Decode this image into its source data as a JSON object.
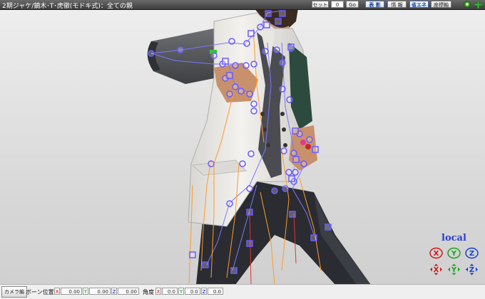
{
  "window": {
    "title": "2期ジャケ/鏑木･T･虎徹(モドキ式)：全ての親"
  },
  "toolbar": {
    "frame_label": "セット",
    "frame_value": "0",
    "go_label": "Go",
    "view_buttons": [
      "表 影",
      "情 報",
      "省エネ",
      "座標軸"
    ],
    "active_view_buttons": [
      "表 影",
      "省エネ"
    ]
  },
  "viewport": {
    "mode_label": "local",
    "gizmo_icons": [
      "rotate-x-icon",
      "rotate-y-icon",
      "rotate-z-icon",
      "move-x-icon",
      "move-y-icon",
      "move-z-icon"
    ],
    "gizmo_letters": {
      "x": "X",
      "y": "Y",
      "z": "Z"
    },
    "colors": {
      "x": "#d11a1a",
      "y": "#1aa31a",
      "z": "#1a44d1",
      "bone_marker": "#6a5cff",
      "ik_bone_marker": "#ff9a2a"
    }
  },
  "bottom_bar": {
    "camera_tab": "カメラ編",
    "bone_position_label": "ボーン位置",
    "angle_label": "角度",
    "axis_letters": {
      "x": "X",
      "y": "Y",
      "z": "Z"
    },
    "position": {
      "x": "0.00",
      "y": "0.00",
      "z": "0.00"
    },
    "angle": {
      "x": "0.0",
      "y": "0.0",
      "z": "0.0"
    }
  }
}
